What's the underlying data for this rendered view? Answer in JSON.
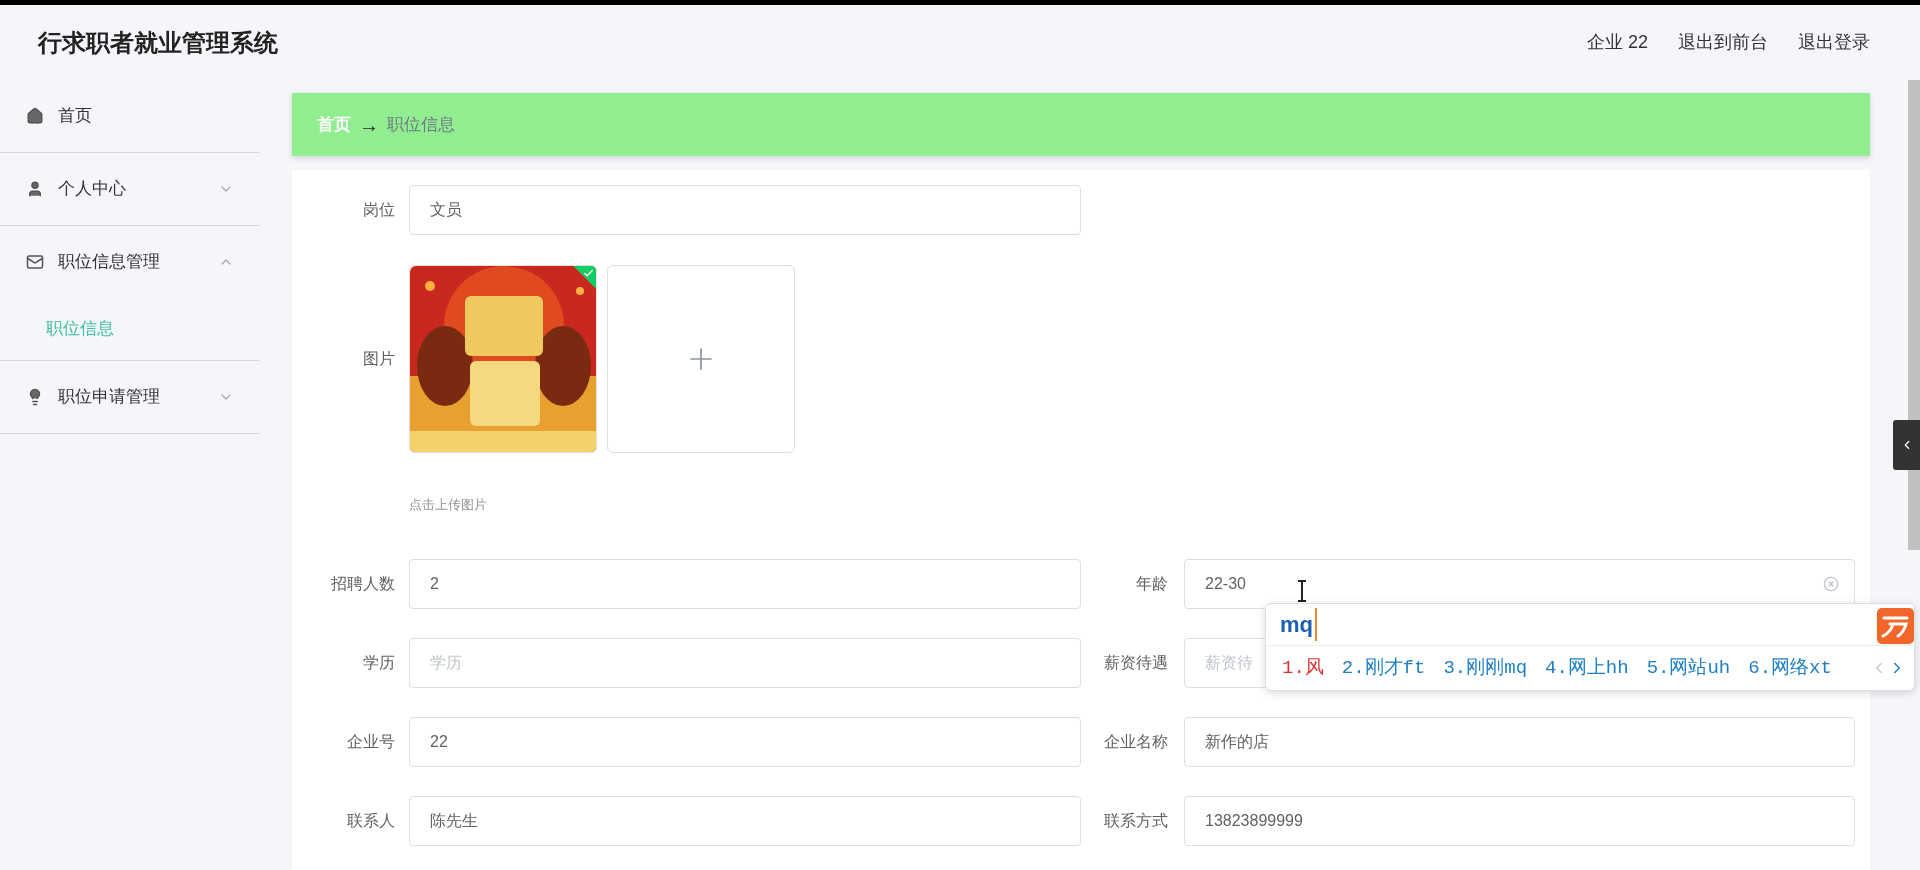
{
  "header": {
    "title": "行求职者就业管理系统",
    "links": [
      "企业 22",
      "退出到前台",
      "退出登录"
    ]
  },
  "sidebar": {
    "items": [
      {
        "label": "首页"
      },
      {
        "label": "个人中心",
        "expanded": false
      },
      {
        "label": "职位信息管理",
        "expanded": true,
        "children": [
          {
            "label": "职位信息",
            "selected": true
          }
        ]
      },
      {
        "label": "职位申请管理",
        "expanded": false
      }
    ]
  },
  "breadcrumb": [
    "首页",
    "→",
    "职位信息"
  ],
  "form": {
    "post": {
      "label": "岗位",
      "value": "文员"
    },
    "picture": {
      "label": "图片",
      "uploaded": true,
      "hint": "点击上传图片"
    },
    "rows": [
      [
        {
          "label": "招聘人数",
          "value": "2"
        },
        {
          "label": "年龄",
          "value": "22-30",
          "clearable": true
        }
      ],
      [
        {
          "label": "学历",
          "placeholder": "学历"
        },
        {
          "label": "薪资待遇",
          "placeholder": "薪资待"
        }
      ],
      [
        {
          "label": "企业号",
          "value": "22"
        },
        {
          "label": "企业名称",
          "value": "新作的店"
        }
      ],
      [
        {
          "label": "联系人",
          "value": "陈先生"
        },
        {
          "label": "联系方式",
          "value": "13823899999"
        }
      ]
    ]
  },
  "ime": {
    "composition": "mq",
    "candidates": [
      {
        "text": "1.风",
        "selected": true
      },
      {
        "text": "2.刚才ft",
        "selected": false
      },
      {
        "text": "3.刚刚mq",
        "selected": false
      },
      {
        "text": "4.网上hh",
        "selected": false
      },
      {
        "text": "5.网站uh",
        "selected": false
      },
      {
        "text": "6.网络xt",
        "selected": false
      }
    ]
  }
}
